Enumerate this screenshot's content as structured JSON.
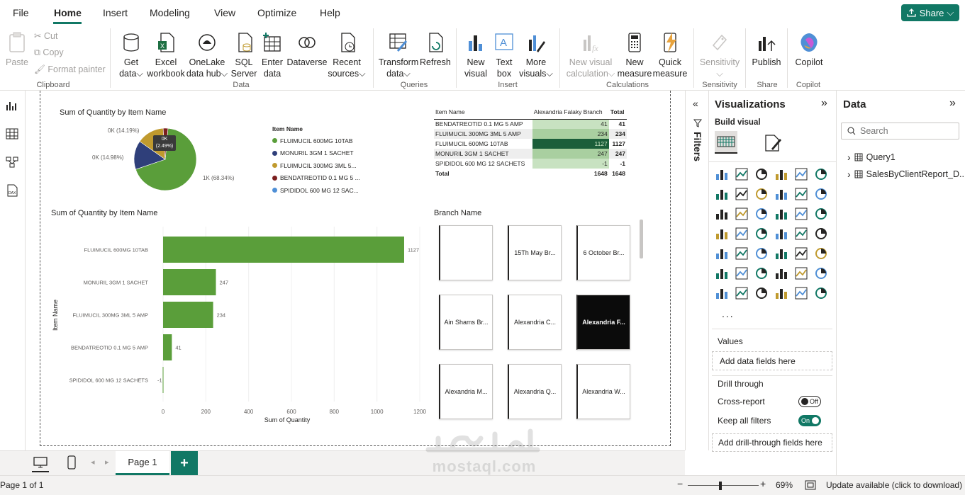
{
  "menu": {
    "items": [
      "File",
      "Home",
      "Insert",
      "Modeling",
      "View",
      "Optimize",
      "Help"
    ],
    "active": "Home",
    "share_label": "Share"
  },
  "ribbon": {
    "clipboard": {
      "paste": "Paste",
      "cut": "Cut",
      "copy": "Copy",
      "format_painter": "Format painter",
      "group": "Clipboard"
    },
    "data": {
      "get_data": [
        "Get",
        "data"
      ],
      "excel": [
        "Excel",
        "workbook"
      ],
      "onelake": [
        "OneLake",
        "data hub"
      ],
      "sql": [
        "SQL",
        "Server"
      ],
      "enter": [
        "Enter",
        "data"
      ],
      "dataverse": "Dataverse",
      "recent": [
        "Recent",
        "sources"
      ],
      "group": "Data"
    },
    "queries": {
      "transform": [
        "Transform",
        "data"
      ],
      "refresh": "Refresh",
      "group": "Queries"
    },
    "insert": {
      "new_visual": [
        "New",
        "visual"
      ],
      "text_box": [
        "Text",
        "box"
      ],
      "more_visuals": [
        "More",
        "visuals"
      ],
      "group": "Insert"
    },
    "calculations": {
      "new_visual_calc": [
        "New visual",
        "calculation"
      ],
      "new_measure": [
        "New",
        "measure"
      ],
      "quick_measure": [
        "Quick",
        "measure"
      ],
      "group": "Calculations"
    },
    "sensitivity": {
      "label": "Sensitivity",
      "group": "Sensitivity"
    },
    "share": {
      "publish": "Publish",
      "group": "Share"
    },
    "copilot": {
      "label": "Copilot",
      "group": "Copilot"
    }
  },
  "pie": {
    "title": "Sum of Quantity by Item Name",
    "legend_title": "Item Name",
    "legend": [
      {
        "label": "FLUIMUCIL 600MG 10TAB",
        "color": "#5a9e3a"
      },
      {
        "label": "MONURIL 3GM 1 SACHET",
        "color": "#2f3f7a"
      },
      {
        "label": "FLUIMUCIL 300MG 3ML 5...",
        "color": "#c09a2e"
      },
      {
        "label": "BENDATREOTID 0.1 MG 5 ...",
        "color": "#7b1f1f"
      },
      {
        "label": "SPIDIDOL 600 MG 12 SAC...",
        "color": "#4f8fd6"
      }
    ],
    "labels": {
      "big": "1K (68.34%)",
      "l1": "0K (14.98%)",
      "l2": "0K (14.19%)",
      "tooltip_line1": "0K",
      "tooltip_line2": "(2.49%)"
    }
  },
  "matrix": {
    "headers": [
      "Item Name",
      "Alexandria Falaky Branch",
      "Total"
    ],
    "rows": [
      [
        "BENDATREOTID 0.1 MG 5 AMP",
        "41",
        "41"
      ],
      [
        "FLUIMUCIL 300MG 3ML 5 AMP",
        "234",
        "234"
      ],
      [
        "FLUIMUCIL 600MG 10TAB",
        "1127",
        "1127"
      ],
      [
        "MONURIL 3GM 1 SACHET",
        "247",
        "247"
      ],
      [
        "SPIDIDOL 600 MG 12 SACHETS",
        "-1",
        "-1"
      ]
    ],
    "total": [
      "Total",
      "1648",
      "1648"
    ]
  },
  "chart_data": {
    "type": "bar",
    "orientation": "horizontal",
    "title": "Sum of Quantity by Item Name",
    "xlabel": "Sum of Quantity",
    "ylabel": "Item Name",
    "categories": [
      "FLUIMUCIL 600MG 10TAB",
      "MONURIL 3GM 1 SACHET",
      "FLUIMUCIL 300MG 3ML 5 AMP",
      "BENDATREOTID 0.1 MG 5 AMP",
      "SPIDIDOL 600 MG 12 SACHETS"
    ],
    "values": [
      1127,
      247,
      234,
      41,
      -1
    ],
    "value_labels": [
      "1127",
      "247",
      "234",
      "41",
      "-1"
    ],
    "xlim": [
      0,
      1200
    ],
    "xticks": [
      "0",
      "200",
      "400",
      "600",
      "800",
      "1000",
      "1200"
    ],
    "color": "#5a9e3a",
    "grid": true
  },
  "slicer": {
    "title": "Branch Name",
    "tiles": [
      "",
      "15Th May Br...",
      "6 October Br...",
      "Ain Shams Br...",
      "Alexandria C...",
      "Alexandria F...",
      "Alexandria M...",
      "Alexandria Q...",
      "Alexandria W..."
    ],
    "selected_index": 5
  },
  "filters_label": "Filters",
  "viz": {
    "title": "Visualizations",
    "build_visual": "Build visual",
    "values_label": "Values",
    "add_data": "Add data fields here",
    "drill_through": "Drill through",
    "cross_report": "Cross-report",
    "cross_report_state": "Off",
    "keep_filters": "Keep all filters",
    "keep_filters_state": "On",
    "add_drill": "Add drill-through fields here",
    "more": "..."
  },
  "data_pane": {
    "title": "Data",
    "search_placeholder": "Search",
    "tables": [
      "Query1",
      "SalesByClientReport_D..."
    ]
  },
  "pages": {
    "tab": "Page 1",
    "add": "+"
  },
  "status": {
    "page_info": "Page 1 of 1",
    "zoom": "69%",
    "update": "Update available (click to download)",
    "watermark": "mostaql.com"
  }
}
